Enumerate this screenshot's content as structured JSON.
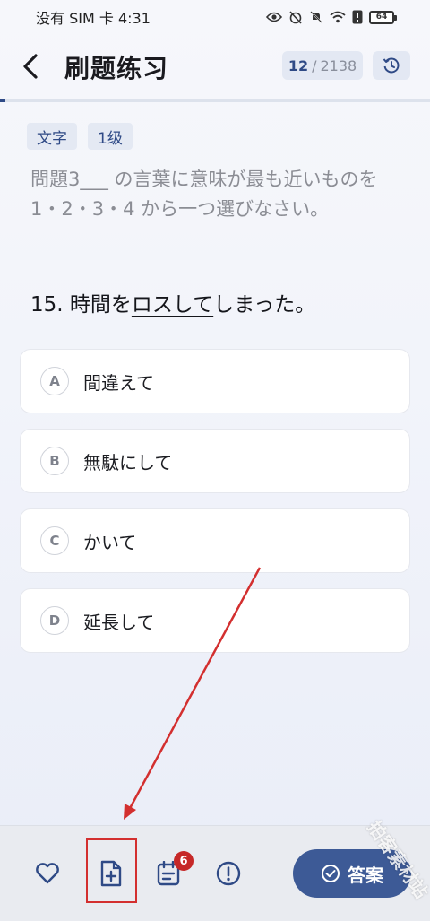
{
  "status_bar": {
    "carrier_time": "没有 SIM 卡 4:31",
    "battery": "64"
  },
  "header": {
    "title": "刷题练习",
    "current": "12",
    "separator": "/",
    "total": "2138"
  },
  "tags": [
    "文字",
    "1级"
  ],
  "instruction": "問題3___ の言葉に意味が最も近いものを 1・2・3・4 から一つ選びなさい。",
  "question": {
    "prefix": "15. 時間を",
    "underlined": "ロスして",
    "suffix": "しまった。"
  },
  "options": [
    {
      "letter": "A",
      "text": "間違えて"
    },
    {
      "letter": "B",
      "text": "無駄にして"
    },
    {
      "letter": "C",
      "text": "かいて"
    },
    {
      "letter": "D",
      "text": "延長して"
    }
  ],
  "bottom_bar": {
    "notes_badge": "6",
    "answer_label": "答案"
  },
  "watermark": "拍客素材站",
  "colors": {
    "accent": "#3d5a96",
    "annotation": "#d32f2f",
    "badge": "#c62828"
  }
}
